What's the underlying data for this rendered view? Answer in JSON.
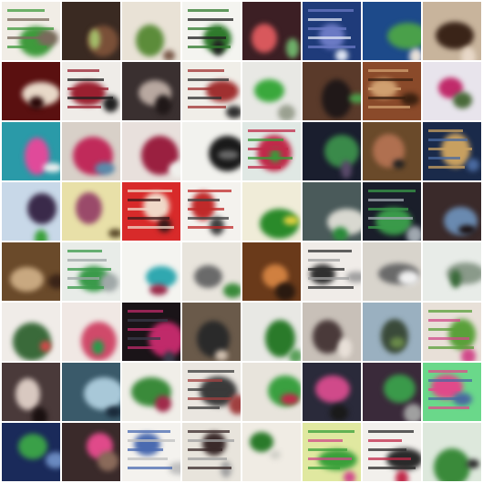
{
  "grid": {
    "rows": 8,
    "cols": 8,
    "tiles": [
      {
        "bg": "#f1ede6",
        "fg": "#3f9a3c",
        "accent": "#7a6a5c",
        "kind": "doc"
      },
      {
        "bg": "#3a2a22",
        "fg": "#7a5038",
        "accent": "#a4be6a",
        "kind": "blob"
      },
      {
        "bg": "#e9e2d6",
        "fg": "#5c8c3a",
        "accent": "#7a5a4a",
        "kind": "blob"
      },
      {
        "bg": "#f4f4f0",
        "fg": "#2f7a2c",
        "accent": "#222222",
        "kind": "doc"
      },
      {
        "bg": "#3c1f24",
        "fg": "#d8585c",
        "accent": "#6fb16a",
        "kind": "blob"
      },
      {
        "bg": "#1f3b7a",
        "fg": "#6b7ac4",
        "accent": "#dfe6f4",
        "kind": "doc"
      },
      {
        "bg": "#1d4a8a",
        "fg": "#4aa04a",
        "accent": "#e8e0d8",
        "kind": "blob"
      },
      {
        "bg": "#c8b49c",
        "fg": "#3a2418",
        "accent": "#e8d8c8",
        "kind": "blob"
      },
      {
        "bg": "#5a1010",
        "fg": "#e8d8c8",
        "accent": "#2a0808",
        "kind": "blob"
      },
      {
        "bg": "#efece8",
        "fg": "#9a2030",
        "accent": "#202020",
        "kind": "doc"
      },
      {
        "bg": "#3a3030",
        "fg": "#b8a8a0",
        "accent": "#201818",
        "kind": "blob"
      },
      {
        "bg": "#f0eee8",
        "fg": "#a03030",
        "accent": "#303030",
        "kind": "doc"
      },
      {
        "bg": "#e8e8e4",
        "fg": "#3aa83c",
        "accent": "#9aa090",
        "kind": "blob"
      },
      {
        "bg": "#5a3a2a",
        "fg": "#201818",
        "accent": "#4aa04a",
        "kind": "blob"
      },
      {
        "bg": "#8a4a2a",
        "fg": "#d0a070",
        "accent": "#3a2010",
        "kind": "doc"
      },
      {
        "bg": "#e8e4ec",
        "fg": "#c02a6a",
        "accent": "#4a6a3a",
        "kind": "blob"
      },
      {
        "bg": "#2a9aa8",
        "fg": "#e04a9a",
        "accent": "#f0f0f0",
        "kind": "blob"
      },
      {
        "bg": "#d8d0c8",
        "fg": "#c02a5a",
        "accent": "#5a8aaa",
        "kind": "blob"
      },
      {
        "bg": "#e8e0dc",
        "fg": "#9a2040",
        "accent": "#f0f0ec",
        "kind": "blob"
      },
      {
        "bg": "#f2f2ee",
        "fg": "#1a1a1a",
        "accent": "#6a6a6a",
        "kind": "blob"
      },
      {
        "bg": "#e0e8e4",
        "fg": "#c02a4a",
        "accent": "#3a9a3a",
        "kind": "doc"
      },
      {
        "bg": "#1a1e2e",
        "fg": "#3a8a4a",
        "accent": "#5a4a6a",
        "kind": "blob"
      },
      {
        "bg": "#6a4a2a",
        "fg": "#b07050",
        "accent": "#202020",
        "kind": "blob"
      },
      {
        "bg": "#1a2a4a",
        "fg": "#c8a060",
        "accent": "#4a6aa0",
        "kind": "doc"
      },
      {
        "bg": "#c8d8e8",
        "fg": "#3a2a4a",
        "accent": "#3aa03a",
        "kind": "blob"
      },
      {
        "bg": "#e8e0a8",
        "fg": "#9a4a6a",
        "accent": "#5a4a2a",
        "kind": "blob"
      },
      {
        "bg": "#d82a2a",
        "fg": "#f0d8c8",
        "accent": "#3a1a1a",
        "kind": "doc"
      },
      {
        "bg": "#f4f2ee",
        "fg": "#c02a2a",
        "accent": "#404040",
        "kind": "doc"
      },
      {
        "bg": "#f0ecd8",
        "fg": "#2a8a2a",
        "accent": "#e0d040",
        "kind": "blob"
      },
      {
        "bg": "#4a5a5a",
        "fg": "#d8d8d0",
        "accent": "#2a8a3a",
        "kind": "blob"
      },
      {
        "bg": "#1a1e2a",
        "fg": "#3a9a4a",
        "accent": "#a0a8b0",
        "kind": "doc"
      },
      {
        "bg": "#3a2a2a",
        "fg": "#6a8ab0",
        "accent": "#1a1010",
        "kind": "blob"
      },
      {
        "bg": "#6a4a2a",
        "fg": "#c8a880",
        "accent": "#3a2418",
        "kind": "blob"
      },
      {
        "bg": "#e8ece8",
        "fg": "#3a9a4a",
        "accent": "#a0a8a8",
        "kind": "doc"
      },
      {
        "bg": "#f4f4f0",
        "fg": "#30a8b0",
        "accent": "#9a2a4a",
        "kind": "blob"
      },
      {
        "bg": "#e8e4dc",
        "fg": "#6a6a6a",
        "accent": "#3a8a3a",
        "kind": "blob"
      },
      {
        "bg": "#6a3a1a",
        "fg": "#d08040",
        "accent": "#2a1a10",
        "kind": "blob"
      },
      {
        "bg": "#f0ece8",
        "fg": "#303030",
        "accent": "#a0a0a0",
        "kind": "doc"
      },
      {
        "bg": "#d8d4cc",
        "fg": "#6a6a6a",
        "accent": "#f0f0f0",
        "kind": "blob"
      },
      {
        "bg": "#e8ece8",
        "fg": "#8a9a8a",
        "accent": "#3a6a3a",
        "kind": "blob"
      },
      {
        "bg": "#f0ece8",
        "fg": "#3a6a3a",
        "accent": "#d04a4a",
        "kind": "blob"
      },
      {
        "bg": "#f0e8e4",
        "fg": "#d04a6a",
        "accent": "#2a9a4a",
        "kind": "blob"
      },
      {
        "bg": "#1a1418",
        "fg": "#c02a6a",
        "accent": "#3a3a4a",
        "kind": "doc"
      },
      {
        "bg": "#6a5a4a",
        "fg": "#2a2a2a",
        "accent": "#d0c0b0",
        "kind": "blob"
      },
      {
        "bg": "#e8e8e4",
        "fg": "#2a7a2a",
        "accent": "#5aa05a",
        "kind": "blob"
      },
      {
        "bg": "#c8c0b8",
        "fg": "#4a3a3a",
        "accent": "#e8e0d8",
        "kind": "blob"
      },
      {
        "bg": "#9ab0c0",
        "fg": "#3a4a3a",
        "accent": "#6a8a4a",
        "kind": "blob"
      },
      {
        "bg": "#e8e0d8",
        "fg": "#5aa03a",
        "accent": "#d04a8a",
        "kind": "doc"
      },
      {
        "bg": "#4a3a3a",
        "fg": "#d8c8c0",
        "accent": "#1a1010",
        "kind": "blob"
      },
      {
        "bg": "#3a5a6a",
        "fg": "#a8c8d8",
        "accent": "#1a2a3a",
        "kind": "blob"
      },
      {
        "bg": "#f0eee8",
        "fg": "#3a8a3a",
        "accent": "#a02a4a",
        "kind": "blob"
      },
      {
        "bg": "#eae6e0",
        "fg": "#3a3a3a",
        "accent": "#a04040",
        "kind": "doc"
      },
      {
        "bg": "#e8e4dc",
        "fg": "#3aa040",
        "accent": "#c02a4a",
        "kind": "blob"
      },
      {
        "bg": "#2a2a3a",
        "fg": "#d04a8a",
        "accent": "#1a1a1a",
        "kind": "blob"
      },
      {
        "bg": "#3a2a3a",
        "fg": "#3a9a4a",
        "accent": "#a0a0a0",
        "kind": "blob"
      },
      {
        "bg": "#6ad88a",
        "fg": "#e04a8a",
        "accent": "#4a6aa0",
        "kind": "doc"
      },
      {
        "bg": "#1a2a5a",
        "fg": "#3aa048",
        "accent": "#6a8ac0",
        "kind": "blob"
      },
      {
        "bg": "#3a2a2a",
        "fg": "#e04a8a",
        "accent": "#8a6a5a",
        "kind": "blob"
      },
      {
        "bg": "#f4f2ee",
        "fg": "#4a6ab0",
        "accent": "#c0c0c0",
        "kind": "doc"
      },
      {
        "bg": "#e8e4dc",
        "fg": "#3a2a2a",
        "accent": "#a0a0a0",
        "kind": "doc"
      },
      {
        "bg": "#f0ece4",
        "fg": "#2a7a2a",
        "accent": "#d0d0c8",
        "kind": "blob"
      },
      {
        "bg": "#e0e8a0",
        "fg": "#3aa03a",
        "accent": "#d04a8a",
        "kind": "doc"
      },
      {
        "bg": "#f2f0ec",
        "fg": "#2a2a2a",
        "accent": "#c02a4a",
        "kind": "doc"
      },
      {
        "bg": "#dde8dc",
        "fg": "#3a8a3a",
        "accent": "#2a2a2a",
        "kind": "blob"
      }
    ]
  }
}
